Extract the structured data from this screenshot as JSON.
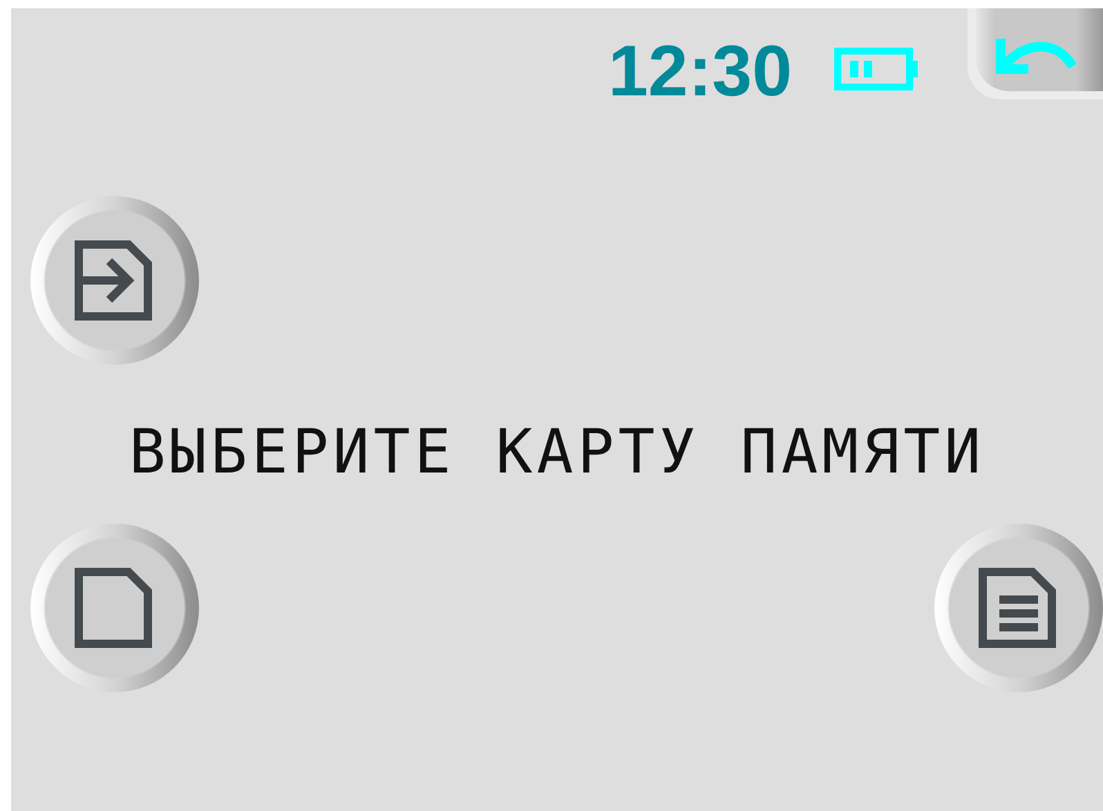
{
  "status": {
    "time": "12:30"
  },
  "message": "ВЫБЕРИТЕ КАРТУ ПАМЯТИ",
  "buttons": [
    {
      "kind": "enter"
    },
    {
      "kind": "card"
    },
    {
      "kind": "list"
    }
  ]
}
